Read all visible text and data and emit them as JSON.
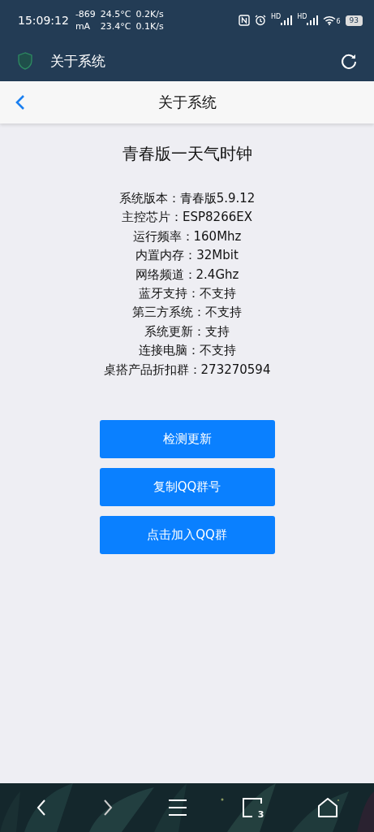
{
  "status_bar": {
    "time": "15:09:12",
    "current": "-869",
    "current_unit": "mA",
    "temps": [
      "24.5°C",
      "23.4°C"
    ],
    "speeds": [
      "0.2K/s",
      "0.1K/s"
    ],
    "signal_labels": [
      "HD",
      "HD"
    ],
    "wifi_label": "6",
    "battery": "93"
  },
  "app_bar": {
    "title": "关于系统"
  },
  "header": {
    "title": "关于系统"
  },
  "content": {
    "heading": "青春版一天气时钟",
    "info_lines": [
      "系统版本：青春版5.9.12",
      "主控芯片：ESP8266EX",
      "运行频率：160Mhz",
      "内置内存：32Mbit",
      "网络频道：2.4Ghz",
      "蓝牙支持：不支持",
      "第三方系统：不支持",
      "系统更新：支持",
      "连接电脑：不支持",
      "桌搭产品折扣群：273270594"
    ],
    "buttons": [
      "检测更新",
      "复制QQ群号",
      "点击加入QQ群"
    ]
  },
  "nav_bar": {
    "tab_count": "3"
  }
}
